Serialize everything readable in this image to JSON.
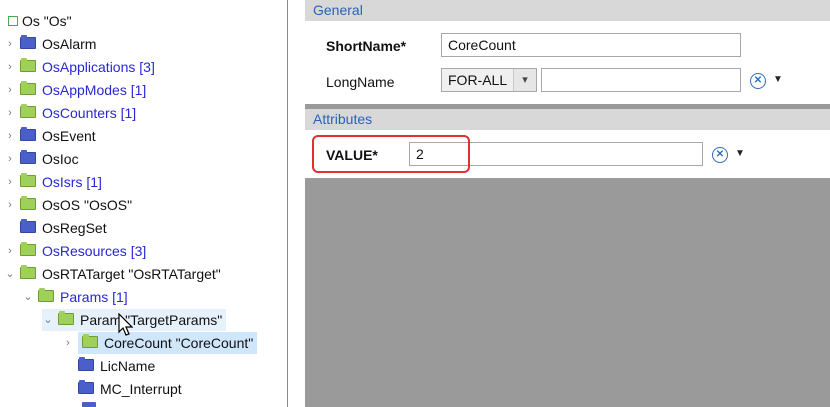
{
  "tree": {
    "root_label": "Os \"Os\"",
    "items": [
      {
        "label": "OsAlarm",
        "style": "plain",
        "folder": "blue",
        "chev": "›"
      },
      {
        "label": "OsApplications [3]",
        "style": "link",
        "folder": "green",
        "chev": "›"
      },
      {
        "label": "OsAppModes [1]",
        "style": "link",
        "folder": "green",
        "chev": "›"
      },
      {
        "label": "OsCounters [1]",
        "style": "link",
        "folder": "green",
        "chev": "›"
      },
      {
        "label": "OsEvent",
        "style": "plain",
        "folder": "blue",
        "chev": "›"
      },
      {
        "label": "OsIoc",
        "style": "plain",
        "folder": "blue",
        "chev": "›"
      },
      {
        "label": "OsIsrs [1]",
        "style": "link",
        "folder": "green",
        "chev": "›"
      },
      {
        "label": "OsOS \"OsOS\"",
        "style": "plain",
        "folder": "green",
        "chev": "›"
      },
      {
        "label": "OsRegSet",
        "style": "plain",
        "folder": "blue",
        "chev": ""
      },
      {
        "label": "OsResources [3]",
        "style": "link",
        "folder": "green",
        "chev": "›"
      },
      {
        "label": "OsRTATarget \"OsRTATarget\"",
        "style": "plain",
        "folder": "green",
        "chev": "⌄"
      },
      {
        "label": "Params [1]",
        "style": "link",
        "folder": "green",
        "chev": "⌄"
      },
      {
        "label": "Param \"TargetParams\"",
        "style": "plain",
        "folder": "green",
        "chev": "⌄"
      },
      {
        "label": "CoreCount \"CoreCount\"",
        "style": "plain",
        "folder": "green",
        "chev": "›"
      },
      {
        "label": "LicName",
        "style": "plain",
        "folder": "blue",
        "chev": ""
      },
      {
        "label": "MC_Interrupt",
        "style": "plain",
        "folder": "blue",
        "chev": ""
      }
    ]
  },
  "general": {
    "header": "General",
    "shortname_label": "ShortName*",
    "shortname_value": "CoreCount",
    "longname_label": "LongName",
    "longname_lang": "FOR-ALL",
    "longname_value": ""
  },
  "attributes": {
    "header": "Attributes",
    "value_label": "VALUE*",
    "value_value": "2"
  },
  "colors": {
    "section_header_text": "#2a62b8",
    "link_text": "#2727d6",
    "selection_bg": "#cfe6fb",
    "highlight_border": "#e03030",
    "empty_area": "#9a9a9a"
  }
}
